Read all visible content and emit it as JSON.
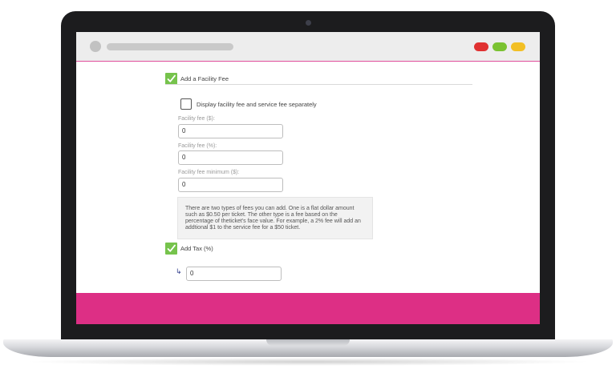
{
  "form": {
    "facility_fee_checkbox_label": "Add a Facility Fee",
    "separate_checkbox_label": "Display facility fee and service fee separately",
    "facility_fee_dollar": {
      "label": "Facility fee ($):",
      "value": "0"
    },
    "facility_fee_percent": {
      "label": "Facility fee (%):",
      "value": "0"
    },
    "facility_fee_minimum": {
      "label": "Facility fee minimum ($):",
      "value": "0"
    },
    "info_text": "There are two types of fees you can add. One is a flat dollar amount such as $0.50 per ticket. The other type is a fee based on the percentage of theticket's face value. For example, a 2% fee will add an addtional $1 to the service fee for a $50 ticket.",
    "tax_checkbox_label": "Add Tax (%)",
    "tax_value": "0"
  },
  "icons": {
    "checkmark": "checkmark-icon",
    "sub_arrow": "arrow-down-right-icon"
  },
  "colors": {
    "accent_pink": "#dd2f85",
    "check_green": "#76c34c",
    "dot_red": "#e03131",
    "dot_green": "#7ac231",
    "dot_yellow": "#f2bf25"
  }
}
